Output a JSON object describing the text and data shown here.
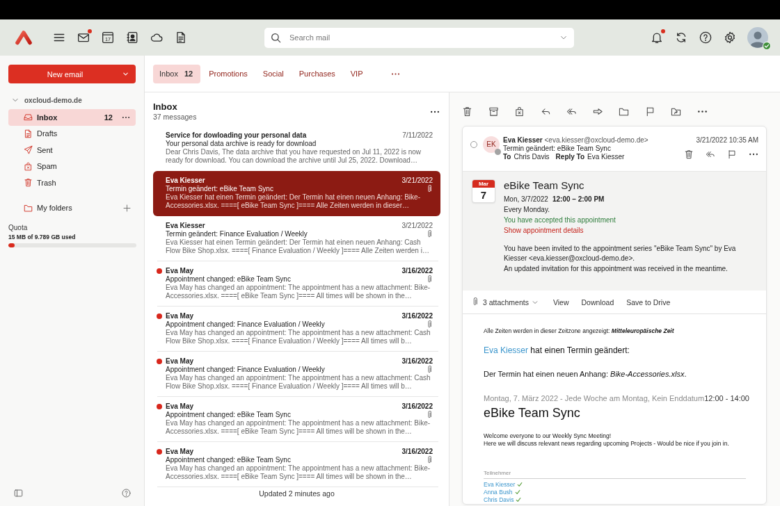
{
  "header": {
    "calendar_day": "17",
    "mail_unread": true,
    "search": {
      "placeholder": "Search mail"
    },
    "notifications_unread": true,
    "user_available": true
  },
  "sidebar": {
    "new_button": "New email",
    "account": {
      "name": "oxcloud-demo.de",
      "expanded": true
    },
    "folders": [
      {
        "kind": "inbox",
        "label": "Inbox",
        "count": "12",
        "selected": true
      },
      {
        "kind": "drafts",
        "label": "Drafts",
        "selected": false
      },
      {
        "kind": "sent",
        "label": "Sent",
        "selected": false
      },
      {
        "kind": "spam",
        "label": "Spam",
        "selected": false
      },
      {
        "kind": "trash",
        "label": "Trash",
        "selected": false
      }
    ],
    "my_folders": "My folders",
    "quota": {
      "title": "Quota",
      "usage": "15 MB of 9.789 GB used",
      "level": 0.05
    }
  },
  "tabs": [
    {
      "label": "Inbox",
      "count": "12",
      "selected": true
    },
    {
      "label": "Promotions",
      "selected": false
    },
    {
      "label": "Social",
      "selected": false
    },
    {
      "label": "Purchases",
      "selected": false
    },
    {
      "label": "VIP",
      "selected": false
    }
  ],
  "list": {
    "title": "Inbox",
    "subtitle": "37 messages",
    "messages": [
      {
        "sender": "Service for dowloading your personal data",
        "subject": "Your personal data archive is ready for download",
        "preview": "Dear Chris Davis, The data archive that you have requested on Jul 11, 2022 is now ready for download. You can download the archive until Jul 25, 2022. Download…",
        "date": "7/11/2022",
        "unread": false,
        "attachment": false,
        "selected": false
      },
      {
        "sender": "Eva Kiesser",
        "subject": "Termin geändert: eBike Team Sync",
        "preview": "Eva Kiesser hat einen Termin geändert: Der Termin hat einen neuen Anhang: Bike-Accessories.xlsx. ====[ eBike Team Sync ]==== Alle Zeiten werden in dieser…",
        "date": "3/21/2022",
        "unread": false,
        "attachment": true,
        "selected": true
      },
      {
        "sender": "Eva Kiesser",
        "subject": "Termin geändert: Finance Evaluation / Weekly",
        "preview": "Eva Kiesser hat einen Termin geändert: Der Termin hat einen neuen Anhang: Cash Flow Bike Shop.xlsx. ====[ Finance Evaluation / Weekly ]==== Alle Zeiten werden i…",
        "date": "3/21/2022",
        "unread": false,
        "attachment": true,
        "selected": false
      },
      {
        "sender": "Eva May",
        "subject": "Appointment changed: eBike Team Sync",
        "preview": "Eva May has changed an appointment: The appointment has a new attachment: Bike-Accessories.xlsx. ====[ eBike Team Sync ]==== All times will be shown in the…",
        "date": "3/16/2022",
        "unread": true,
        "attachment": true,
        "selected": false
      },
      {
        "sender": "Eva May",
        "subject": "Appointment changed: Finance Evaluation / Weekly",
        "preview": "Eva May has changed an appointment: The appointment has a new attachment: Cash Flow Bike Shop.xlsx. ====[ Finance Evaluation / Weekly ]==== All times will b…",
        "date": "3/16/2022",
        "unread": true,
        "attachment": true,
        "selected": false
      },
      {
        "sender": "Eva May",
        "subject": "Appointment changed: Finance Evaluation / Weekly",
        "preview": "Eva May has changed an appointment: The appointment has a new attachment: Cash Flow Bike Shop.xlsx. ====[ Finance Evaluation / Weekly ]==== All times will b…",
        "date": "3/16/2022",
        "unread": true,
        "attachment": true,
        "selected": false
      },
      {
        "sender": "Eva May",
        "subject": "Appointment changed: eBike Team Sync",
        "preview": "Eva May has changed an appointment: The appointment has a new attachment: Bike-Accessories.xlsx. ====[ eBike Team Sync ]==== All times will be shown in the…",
        "date": "3/16/2022",
        "unread": true,
        "attachment": true,
        "selected": false
      },
      {
        "sender": "Eva May",
        "subject": "Appointment changed: eBike Team Sync",
        "preview": "Eva May has changed an appointment: The appointment has a new attachment: Bike-Accessories.xlsx. ====[ eBike Team Sync ]==== All times will be shown in the…",
        "date": "3/16/2022",
        "unread": true,
        "attachment": true,
        "selected": false
      }
    ],
    "footer": "Updated 2 minutes ago"
  },
  "reader": {
    "checked": false,
    "initials": "EK",
    "sender_online": false,
    "sender_name": "Eva Kiesser",
    "sender_email": "<eva.kiesser@oxcloud-demo.de>",
    "date": "3/21/2022 10:35 AM",
    "subject": "Termin geändert: eBike Team Sync",
    "to_label": "To",
    "to": "Chris Davis",
    "reply_to_label": "Reply To",
    "reply_to": "Eva Kiesser",
    "appointment": {
      "month": "Mar",
      "day": "7",
      "title": "eBike Team Sync",
      "date": "Mon, 3/7/2022",
      "time": "12:00 – 2:00 PM",
      "recurrence": "Every Monday.",
      "response_text": "You have accepted this appointment",
      "details_link": "Show appointment details",
      "message": [
        "You have been invited to the appointment series \"eBike Team Sync\" by Eva Kiesser <eva.kiesser@oxcloud-demo.de>.",
        "An updated invitation for this appointment was received in the meantime."
      ]
    },
    "attachments": {
      "label": "3 attachments",
      "actions": [
        "View",
        "Download",
        "Save to Drive"
      ]
    },
    "body": {
      "timezone": "Alle Zeiten werden in dieser Zeitzone angezeigt: **Mitteleuropäische Zeit**",
      "changer": "Eva Kiesser",
      "change_text": "hat einen Termin geändert:",
      "attachment_note": "Der Termin hat einen neuen Anhang: *Bike-Accessories.xlsx*.",
      "schedule": "Montag, 7. März 2022 - Jede Woche am Montag, Kein Enddatum",
      "time": "12:00 - 14:00",
      "title": "eBike Team Sync",
      "welcome": [
        "Welcome everyone to our Weekly Sync Meeting!",
        "Here we will discuss relevant news regarding upcoming Projects - Would be nice if you join in."
      ],
      "participants_label": "Teilnehmer",
      "participants": [
        {
          "name": "Eva Kiesser",
          "accepted": true
        },
        {
          "name": "Anna Bush",
          "accepted": true
        },
        {
          "name": "Chris Davis",
          "accepted": true
        }
      ]
    }
  }
}
